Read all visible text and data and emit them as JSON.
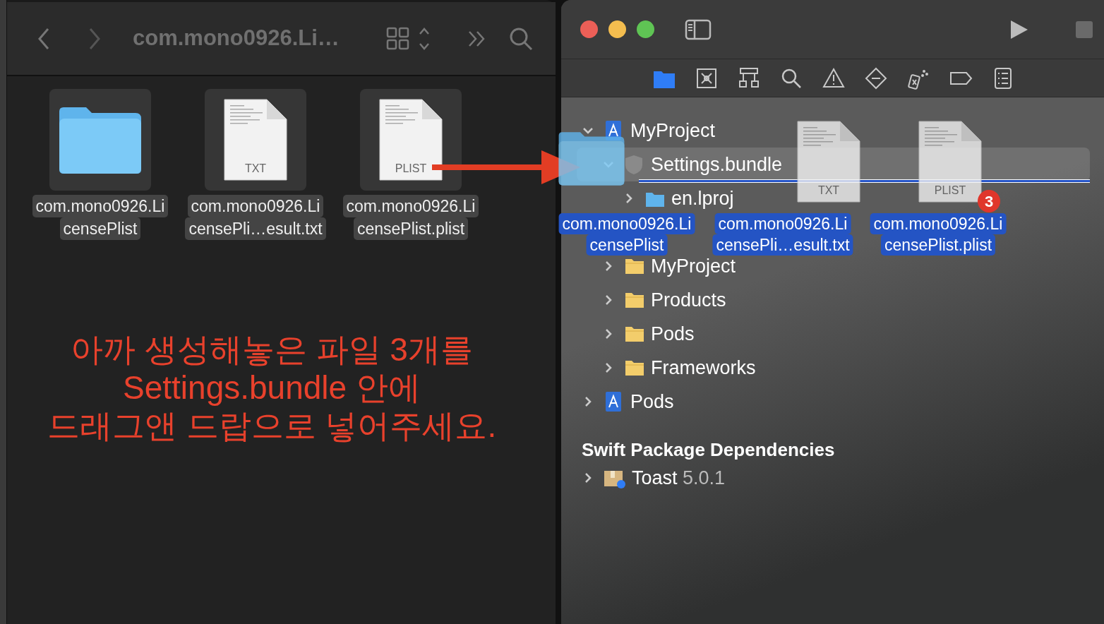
{
  "finder": {
    "title": "com.mono0926.Li…",
    "files": [
      {
        "kind": "folder",
        "label_lines": [
          "com.mono0926.Li",
          "censePlist"
        ]
      },
      {
        "kind": "document",
        "type_label": "TXT",
        "label_lines": [
          "com.mono0926.Li",
          "censePli…esult.txt"
        ]
      },
      {
        "kind": "document",
        "type_label": "PLIST",
        "label_lines": [
          "com.mono0926.Li",
          "censePlist.plist"
        ]
      }
    ],
    "annotation": "아까 생성해놓은 파일 3개를\nSettings.bundle 안에\n드래그앤 드랍으로 넣어주세요."
  },
  "xcode": {
    "navigator_tabs": [
      {
        "kind": "folder",
        "selected": true
      },
      {
        "kind": "source-control",
        "selected": false
      },
      {
        "kind": "hierarchy",
        "selected": false
      },
      {
        "kind": "search",
        "selected": false
      },
      {
        "kind": "warning",
        "selected": false
      },
      {
        "kind": "breakpoint",
        "selected": false
      },
      {
        "kind": "test",
        "selected": false
      },
      {
        "kind": "tag",
        "selected": false
      },
      {
        "kind": "list",
        "selected": false
      }
    ],
    "tree": [
      {
        "label": "MyProject",
        "kind": "project",
        "expanded": true,
        "selected": false,
        "children": [
          {
            "label": "Settings.bundle",
            "kind": "bundle",
            "expanded": true,
            "selected": true,
            "children": [
              {
                "label": "en.lproj",
                "kind": "blue-folder",
                "expanded": false,
                "selected": false
              }
            ]
          },
          {
            "label": "MyProject",
            "kind": "folder",
            "expanded": false,
            "selected": false
          },
          {
            "label": "Products",
            "kind": "folder",
            "expanded": false,
            "selected": false
          },
          {
            "label": "Pods",
            "kind": "folder",
            "expanded": false,
            "selected": false
          },
          {
            "label": "Frameworks",
            "kind": "folder",
            "expanded": false,
            "selected": false
          }
        ]
      },
      {
        "label": "Pods",
        "kind": "project",
        "expanded": false,
        "selected": false
      }
    ],
    "package_section": "Swift Package Dependencies",
    "packages": [
      {
        "name": "Toast",
        "version": "5.0.1",
        "expanded": false
      }
    ]
  },
  "drag": {
    "count": "3",
    "items": [
      {
        "kind": "folder",
        "label_lines": [
          "com.mono0926.Li",
          "censePlist"
        ]
      },
      {
        "kind": "document",
        "type_label": "TXT",
        "label_lines": [
          "com.mono0926.Li",
          "censePli…esult.txt"
        ]
      },
      {
        "kind": "document",
        "type_label": "PLIST",
        "label_lines": [
          "com.mono0926.Li",
          "censePlist.plist"
        ]
      }
    ]
  }
}
